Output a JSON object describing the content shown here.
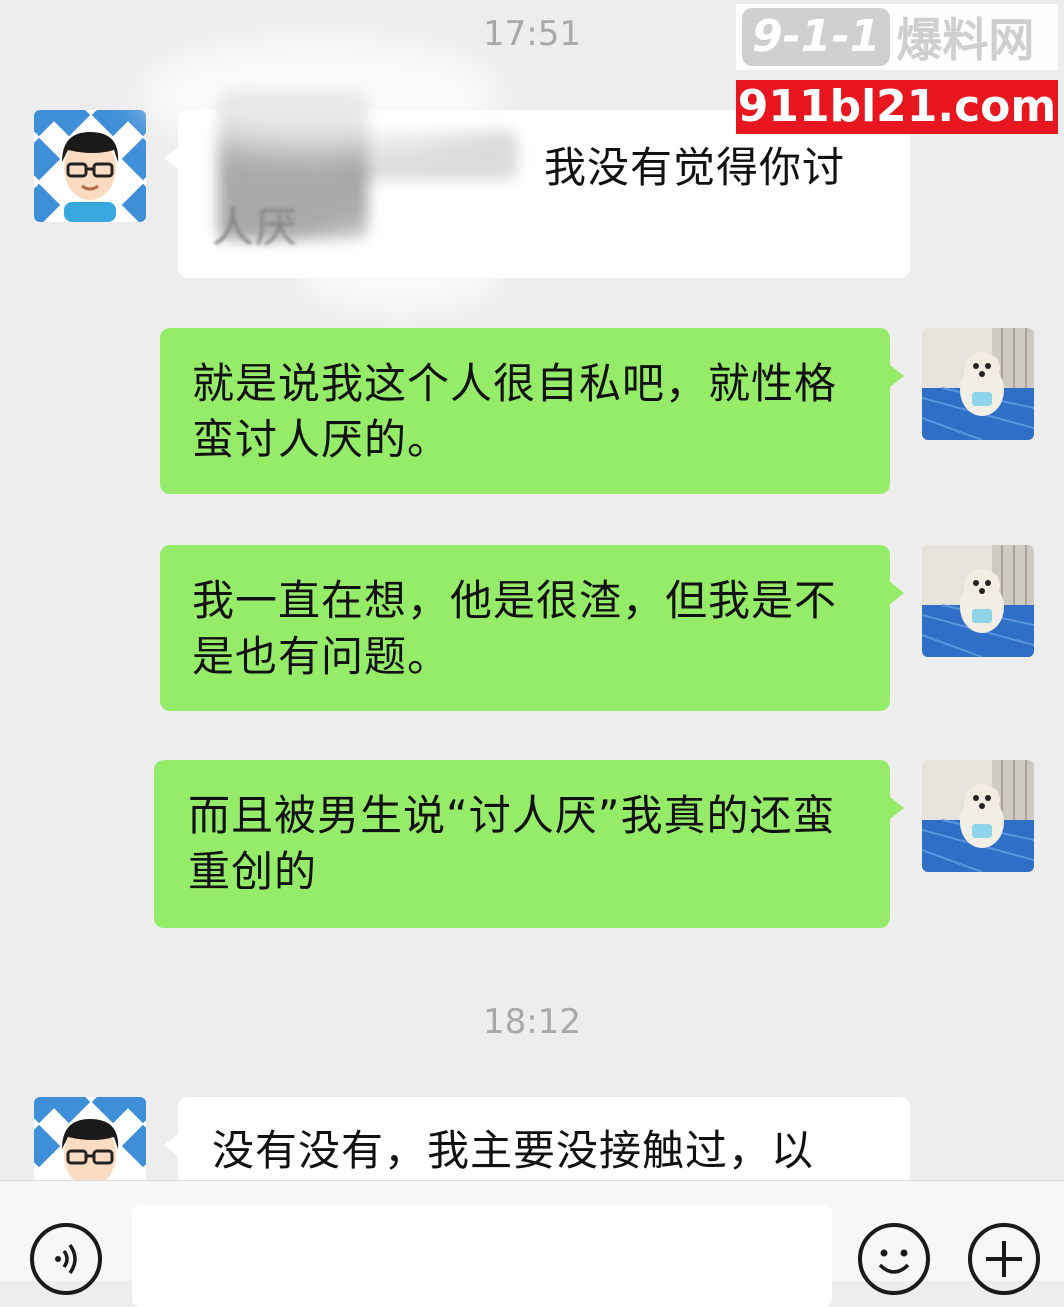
{
  "watermark": {
    "badge": "9-1-1",
    "name": "爆料网",
    "url": "911bl21.com"
  },
  "chat": {
    "time1": "17:51",
    "time2": "18:12",
    "messages": [
      {
        "side": "left",
        "text": "我没有觉得你讨",
        "text2": "人厌"
      },
      {
        "side": "right",
        "text": "就是说我这个人很自私吧，就性格蛮讨人厌的。"
      },
      {
        "side": "right",
        "text": "我一直在想，他是很渣，但我是不是也有问题。"
      },
      {
        "side": "right",
        "text": "而且被男生说“讨人厌”我真的还蛮重创的"
      },
      {
        "side": "left",
        "text": "没有没有，我主要没接触过，以"
      }
    ]
  },
  "colors": {
    "background": "#ededed",
    "outgoing": "#95ec69",
    "incoming": "#ffffff",
    "watermark_red": "#e8171f"
  },
  "icons": {
    "voice": "voice-icon",
    "emoji": "emoji-icon",
    "plus": "plus-icon"
  }
}
